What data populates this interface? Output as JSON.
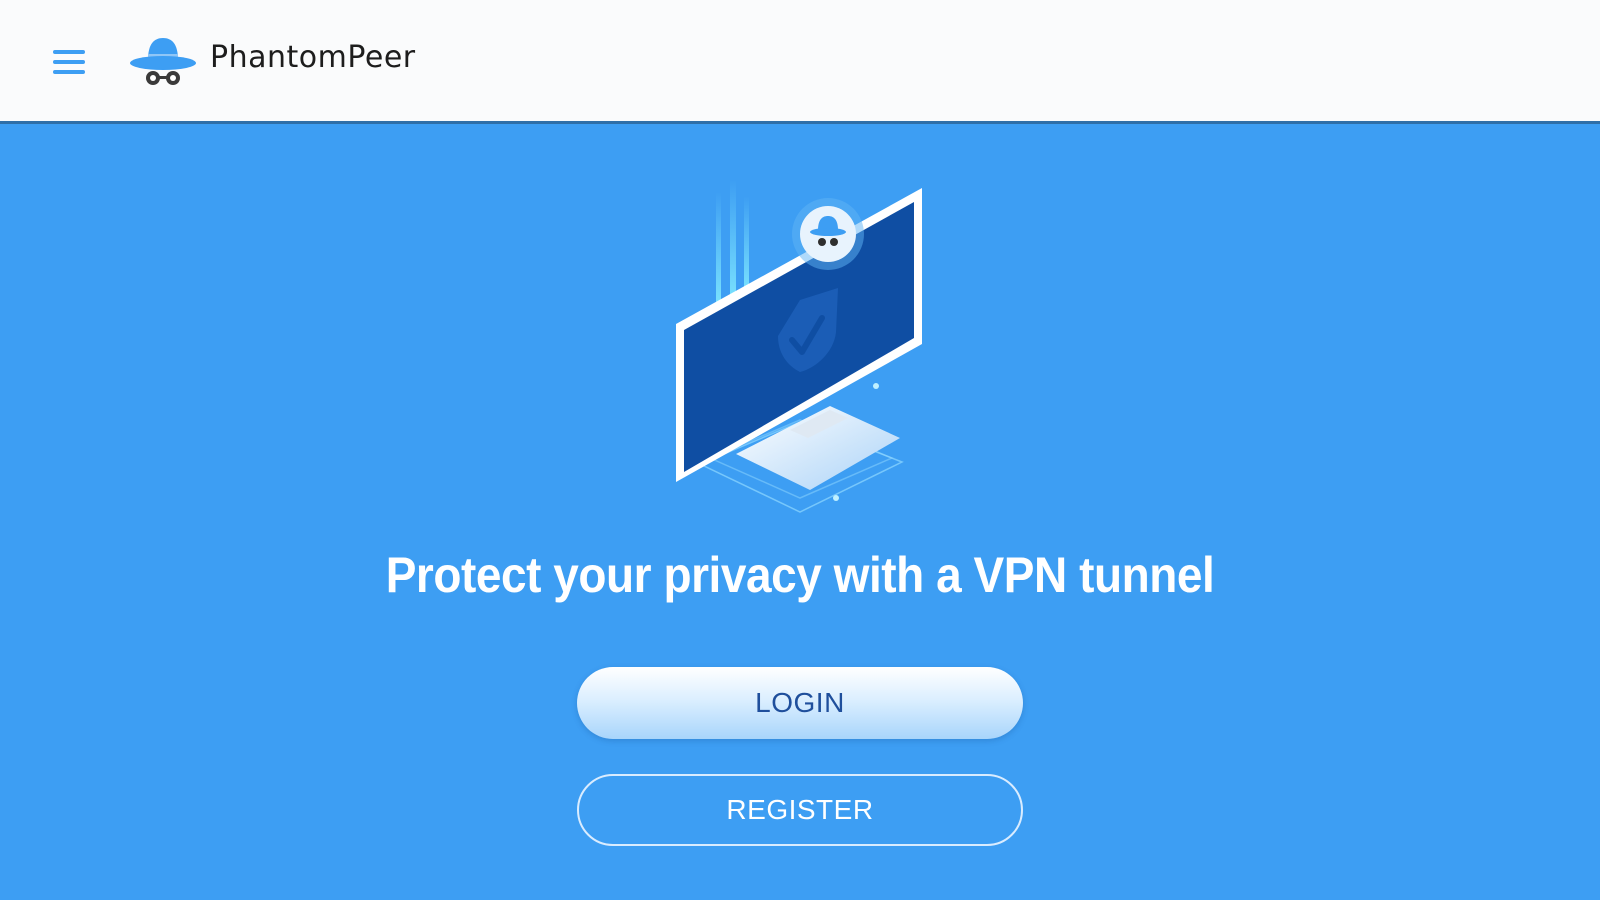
{
  "header": {
    "brand_name": "PhantomPeer",
    "menu_icon": "hamburger-menu-icon",
    "logo_icon": "incognito-hat-logo-icon"
  },
  "main": {
    "illustration": "monitor-shield-check-illustration",
    "headline": "Protect your privacy with a VPN tunnel",
    "login_label": "LOGIN",
    "register_label": "REGISTER"
  },
  "colors": {
    "background": "#3d9ef3",
    "topbar": "#fafbfc",
    "accent": "#3d9ef3",
    "screen": "#0f4ea3",
    "login_text": "#1f4f9c"
  }
}
